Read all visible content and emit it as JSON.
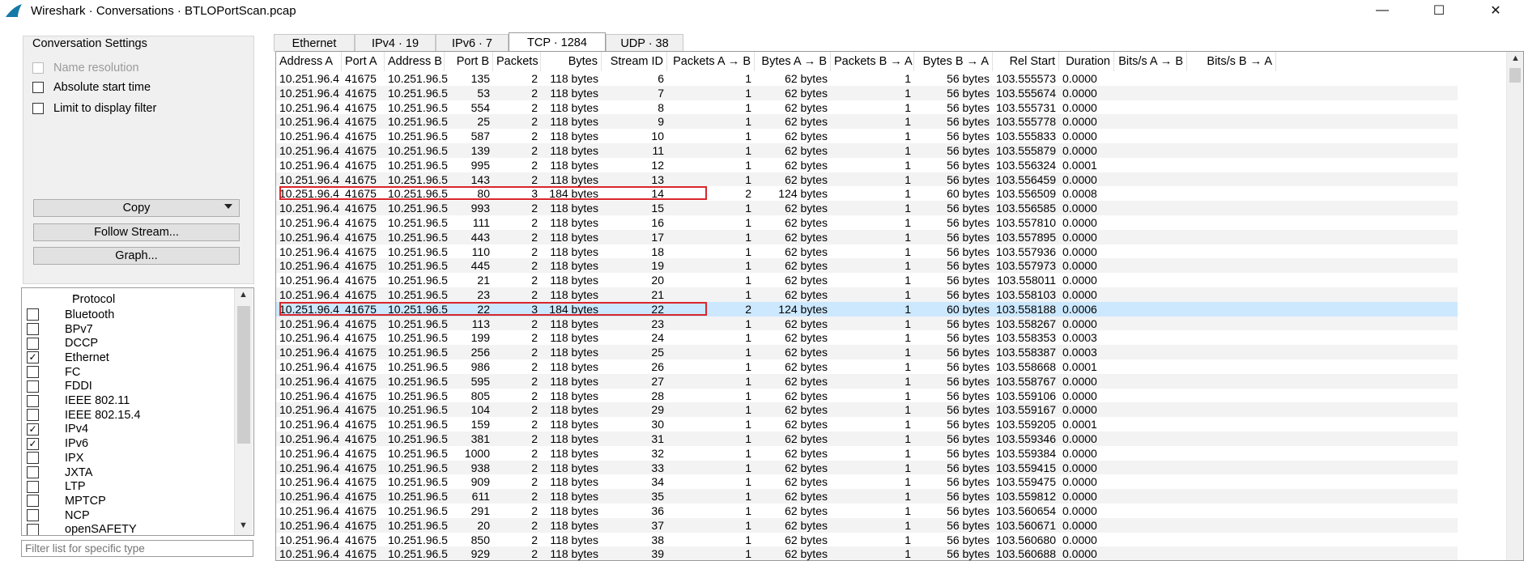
{
  "window": {
    "title": "Wireshark · Conversations · BTLOPortScan.pcap",
    "minimize": "—",
    "maximize": "☐",
    "close": "✕"
  },
  "settings": {
    "legend": "Conversation Settings",
    "name_resolution": "Name resolution",
    "absolute_start_time": "Absolute start time",
    "limit_to_display_filter": "Limit to display filter"
  },
  "buttons": {
    "copy": "Copy",
    "follow_stream": "Follow Stream...",
    "graph": "Graph..."
  },
  "protocols": {
    "header": "Protocol",
    "items": [
      {
        "name": "Bluetooth",
        "checked": false
      },
      {
        "name": "BPv7",
        "checked": false
      },
      {
        "name": "DCCP",
        "checked": false
      },
      {
        "name": "Ethernet",
        "checked": true
      },
      {
        "name": "FC",
        "checked": false
      },
      {
        "name": "FDDI",
        "checked": false
      },
      {
        "name": "IEEE 802.11",
        "checked": false
      },
      {
        "name": "IEEE 802.15.4",
        "checked": false
      },
      {
        "name": "IPv4",
        "checked": true
      },
      {
        "name": "IPv6",
        "checked": true
      },
      {
        "name": "IPX",
        "checked": false
      },
      {
        "name": "JXTA",
        "checked": false
      },
      {
        "name": "LTP",
        "checked": false
      },
      {
        "name": "MPTCP",
        "checked": false
      },
      {
        "name": "NCP",
        "checked": false
      },
      {
        "name": "openSAFETY",
        "checked": false
      }
    ]
  },
  "filter": {
    "placeholder": "Filter list for specific type"
  },
  "tabs": [
    "Ethernet",
    "IPv4 · 19",
    "IPv6 · 7",
    "TCP · 1284",
    "UDP · 38"
  ],
  "active_tab": "TCP · 1284",
  "columns": [
    "Address A",
    "Port A",
    "Address B",
    "Port B",
    "Packets",
    "Bytes",
    "Stream ID",
    "Packets A → B",
    "Bytes A → B",
    "Packets B → A",
    "Bytes B → A",
    "Rel Start",
    "Duration",
    "Bits/s A → B",
    "Bits/s B → A"
  ],
  "rows": [
    [
      "10.251.96.4",
      "41675",
      "10.251.96.5",
      "135",
      "2",
      "118 bytes",
      "6",
      "1",
      "62 bytes",
      "1",
      "56 bytes",
      "103.555573",
      "0.0000",
      "",
      ""
    ],
    [
      "10.251.96.4",
      "41675",
      "10.251.96.5",
      "53",
      "2",
      "118 bytes",
      "7",
      "1",
      "62 bytes",
      "1",
      "56 bytes",
      "103.555674",
      "0.0000",
      "",
      ""
    ],
    [
      "10.251.96.4",
      "41675",
      "10.251.96.5",
      "554",
      "2",
      "118 bytes",
      "8",
      "1",
      "62 bytes",
      "1",
      "56 bytes",
      "103.555731",
      "0.0000",
      "",
      ""
    ],
    [
      "10.251.96.4",
      "41675",
      "10.251.96.5",
      "25",
      "2",
      "118 bytes",
      "9",
      "1",
      "62 bytes",
      "1",
      "56 bytes",
      "103.555778",
      "0.0000",
      "",
      ""
    ],
    [
      "10.251.96.4",
      "41675",
      "10.251.96.5",
      "587",
      "2",
      "118 bytes",
      "10",
      "1",
      "62 bytes",
      "1",
      "56 bytes",
      "103.555833",
      "0.0000",
      "",
      ""
    ],
    [
      "10.251.96.4",
      "41675",
      "10.251.96.5",
      "139",
      "2",
      "118 bytes",
      "11",
      "1",
      "62 bytes",
      "1",
      "56 bytes",
      "103.555879",
      "0.0000",
      "",
      ""
    ],
    [
      "10.251.96.4",
      "41675",
      "10.251.96.5",
      "995",
      "2",
      "118 bytes",
      "12",
      "1",
      "62 bytes",
      "1",
      "56 bytes",
      "103.556324",
      "0.0001",
      "",
      ""
    ],
    [
      "10.251.96.4",
      "41675",
      "10.251.96.5",
      "143",
      "2",
      "118 bytes",
      "13",
      "1",
      "62 bytes",
      "1",
      "56 bytes",
      "103.556459",
      "0.0000",
      "",
      ""
    ],
    [
      "10.251.96.4",
      "41675",
      "10.251.96.5",
      "80",
      "3",
      "184 bytes",
      "14",
      "2",
      "124 bytes",
      "1",
      "60 bytes",
      "103.556509",
      "0.0008",
      "",
      ""
    ],
    [
      "10.251.96.4",
      "41675",
      "10.251.96.5",
      "993",
      "2",
      "118 bytes",
      "15",
      "1",
      "62 bytes",
      "1",
      "56 bytes",
      "103.556585",
      "0.0000",
      "",
      ""
    ],
    [
      "10.251.96.4",
      "41675",
      "10.251.96.5",
      "111",
      "2",
      "118 bytes",
      "16",
      "1",
      "62 bytes",
      "1",
      "56 bytes",
      "103.557810",
      "0.0000",
      "",
      ""
    ],
    [
      "10.251.96.4",
      "41675",
      "10.251.96.5",
      "443",
      "2",
      "118 bytes",
      "17",
      "1",
      "62 bytes",
      "1",
      "56 bytes",
      "103.557895",
      "0.0000",
      "",
      ""
    ],
    [
      "10.251.96.4",
      "41675",
      "10.251.96.5",
      "110",
      "2",
      "118 bytes",
      "18",
      "1",
      "62 bytes",
      "1",
      "56 bytes",
      "103.557936",
      "0.0000",
      "",
      ""
    ],
    [
      "10.251.96.4",
      "41675",
      "10.251.96.5",
      "445",
      "2",
      "118 bytes",
      "19",
      "1",
      "62 bytes",
      "1",
      "56 bytes",
      "103.557973",
      "0.0000",
      "",
      ""
    ],
    [
      "10.251.96.4",
      "41675",
      "10.251.96.5",
      "21",
      "2",
      "118 bytes",
      "20",
      "1",
      "62 bytes",
      "1",
      "56 bytes",
      "103.558011",
      "0.0000",
      "",
      ""
    ],
    [
      "10.251.96.4",
      "41675",
      "10.251.96.5",
      "23",
      "2",
      "118 bytes",
      "21",
      "1",
      "62 bytes",
      "1",
      "56 bytes",
      "103.558103",
      "0.0000",
      "",
      ""
    ],
    [
      "10.251.96.4",
      "41675",
      "10.251.96.5",
      "22",
      "3",
      "184 bytes",
      "22",
      "2",
      "124 bytes",
      "1",
      "60 bytes",
      "103.558188",
      "0.0006",
      "",
      ""
    ],
    [
      "10.251.96.4",
      "41675",
      "10.251.96.5",
      "113",
      "2",
      "118 bytes",
      "23",
      "1",
      "62 bytes",
      "1",
      "56 bytes",
      "103.558267",
      "0.0000",
      "",
      ""
    ],
    [
      "10.251.96.4",
      "41675",
      "10.251.96.5",
      "199",
      "2",
      "118 bytes",
      "24",
      "1",
      "62 bytes",
      "1",
      "56 bytes",
      "103.558353",
      "0.0003",
      "",
      ""
    ],
    [
      "10.251.96.4",
      "41675",
      "10.251.96.5",
      "256",
      "2",
      "118 bytes",
      "25",
      "1",
      "62 bytes",
      "1",
      "56 bytes",
      "103.558387",
      "0.0003",
      "",
      ""
    ],
    [
      "10.251.96.4",
      "41675",
      "10.251.96.5",
      "986",
      "2",
      "118 bytes",
      "26",
      "1",
      "62 bytes",
      "1",
      "56 bytes",
      "103.558668",
      "0.0001",
      "",
      ""
    ],
    [
      "10.251.96.4",
      "41675",
      "10.251.96.5",
      "595",
      "2",
      "118 bytes",
      "27",
      "1",
      "62 bytes",
      "1",
      "56 bytes",
      "103.558767",
      "0.0000",
      "",
      ""
    ],
    [
      "10.251.96.4",
      "41675",
      "10.251.96.5",
      "805",
      "2",
      "118 bytes",
      "28",
      "1",
      "62 bytes",
      "1",
      "56 bytes",
      "103.559106",
      "0.0000",
      "",
      ""
    ],
    [
      "10.251.96.4",
      "41675",
      "10.251.96.5",
      "104",
      "2",
      "118 bytes",
      "29",
      "1",
      "62 bytes",
      "1",
      "56 bytes",
      "103.559167",
      "0.0000",
      "",
      ""
    ],
    [
      "10.251.96.4",
      "41675",
      "10.251.96.5",
      "159",
      "2",
      "118 bytes",
      "30",
      "1",
      "62 bytes",
      "1",
      "56 bytes",
      "103.559205",
      "0.0001",
      "",
      ""
    ],
    [
      "10.251.96.4",
      "41675",
      "10.251.96.5",
      "381",
      "2",
      "118 bytes",
      "31",
      "1",
      "62 bytes",
      "1",
      "56 bytes",
      "103.559346",
      "0.0000",
      "",
      ""
    ],
    [
      "10.251.96.4",
      "41675",
      "10.251.96.5",
      "1000",
      "2",
      "118 bytes",
      "32",
      "1",
      "62 bytes",
      "1",
      "56 bytes",
      "103.559384",
      "0.0000",
      "",
      ""
    ],
    [
      "10.251.96.4",
      "41675",
      "10.251.96.5",
      "938",
      "2",
      "118 bytes",
      "33",
      "1",
      "62 bytes",
      "1",
      "56 bytes",
      "103.559415",
      "0.0000",
      "",
      ""
    ],
    [
      "10.251.96.4",
      "41675",
      "10.251.96.5",
      "909",
      "2",
      "118 bytes",
      "34",
      "1",
      "62 bytes",
      "1",
      "56 bytes",
      "103.559475",
      "0.0000",
      "",
      ""
    ],
    [
      "10.251.96.4",
      "41675",
      "10.251.96.5",
      "611",
      "2",
      "118 bytes",
      "35",
      "1",
      "62 bytes",
      "1",
      "56 bytes",
      "103.559812",
      "0.0000",
      "",
      ""
    ],
    [
      "10.251.96.4",
      "41675",
      "10.251.96.5",
      "291",
      "2",
      "118 bytes",
      "36",
      "1",
      "62 bytes",
      "1",
      "56 bytes",
      "103.560654",
      "0.0000",
      "",
      ""
    ],
    [
      "10.251.96.4",
      "41675",
      "10.251.96.5",
      "20",
      "2",
      "118 bytes",
      "37",
      "1",
      "62 bytes",
      "1",
      "56 bytes",
      "103.560671",
      "0.0000",
      "",
      ""
    ],
    [
      "10.251.96.4",
      "41675",
      "10.251.96.5",
      "850",
      "2",
      "118 bytes",
      "38",
      "1",
      "62 bytes",
      "1",
      "56 bytes",
      "103.560680",
      "0.0000",
      "",
      ""
    ],
    [
      "10.251.96.4",
      "41675",
      "10.251.96.5",
      "929",
      "2",
      "118 bytes",
      "39",
      "1",
      "62 bytes",
      "1",
      "56 bytes",
      "103.560688",
      "0.0000",
      "",
      ""
    ]
  ],
  "selected_row": 16,
  "highlighted_rows": [
    8,
    16
  ],
  "colors": {
    "selection": "#cce8ff",
    "highlight_border": "#d9262a",
    "alt_row": "#f3f3f3"
  }
}
